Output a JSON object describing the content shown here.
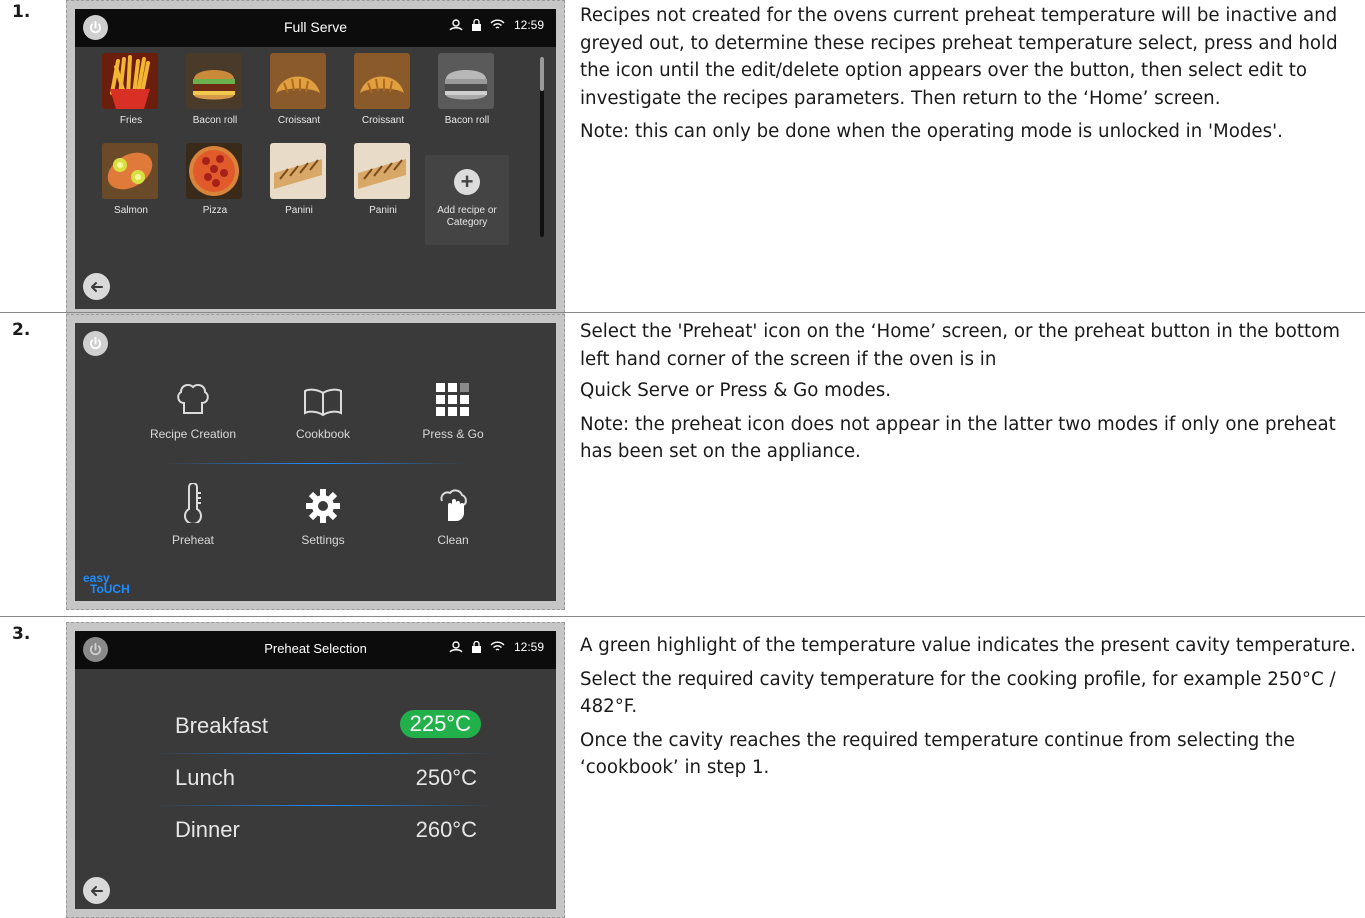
{
  "steps": [
    {
      "number": "1.",
      "screen": {
        "title": "Full Serve",
        "time": "12:59",
        "recipes": [
          {
            "label": "Fries",
            "icon": "fries-image"
          },
          {
            "label": "Bacon roll",
            "icon": "burger-image"
          },
          {
            "label": "Croissant",
            "icon": "croissant-image"
          },
          {
            "label": "Croissant",
            "icon": "croissant-image"
          },
          {
            "label": "Bacon roll",
            "icon": "burger-image-greyed"
          },
          {
            "label": "Salmon",
            "icon": "salmon-image"
          },
          {
            "label": "Pizza",
            "icon": "pizza-image"
          },
          {
            "label": "Panini",
            "icon": "panini-image"
          },
          {
            "label": "Panini",
            "icon": "panini-image"
          }
        ],
        "add_tile_label_1": "Add recipe or",
        "add_tile_label_2": "Category"
      },
      "paragraphs": [
        "Recipes not created for the ovens current preheat temperature will be inactive and greyed out, to determine these recipes preheat temperature select, press and hold the icon until the edit/delete option appears over the button, then select edit to investigate the recipes parameters. Then return to the ‘Home’ screen.",
        "Note: this can only be done when the operating mode is unlocked in 'Modes'."
      ]
    },
    {
      "number": "2.",
      "screen": {
        "menu": [
          {
            "label": "Recipe Creation",
            "icon": "chef-hat-icon"
          },
          {
            "label": "Cookbook",
            "icon": "book-icon"
          },
          {
            "label": "Press & Go",
            "icon": "grid-icon"
          },
          {
            "label": "Preheat",
            "icon": "thermometer-icon"
          },
          {
            "label": "Settings",
            "icon": "gear-icon"
          },
          {
            "label": "Clean",
            "icon": "clean-hand-icon"
          }
        ],
        "brand_line_1": "easy",
        "brand_line_2": "ToUCH"
      },
      "paragraphs": [
        "Select the 'Preheat' icon on the ‘Home’ screen, or the preheat button in the bottom left hand corner of the screen if the oven is in",
        "Quick Serve or Press & Go modes.",
        "Note: the preheat icon does not appear in the latter two modes if only one preheat has been set on the appliance."
      ]
    },
    {
      "number": "3.",
      "screen": {
        "title": "Preheat Selection",
        "time": "12:59",
        "options": [
          {
            "name": "Breakfast",
            "temp": "225°C",
            "active": true
          },
          {
            "name": "Lunch",
            "temp": "250°C",
            "active": false
          },
          {
            "name": "Dinner",
            "temp": "260°C",
            "active": false
          }
        ],
        "active_color": "#22b04a"
      },
      "paragraphs": [
        "A green highlight of the temperature value indicates the present cavity temperature.",
        "Select the required cavity temperature for the cooking profile, for example 250°C / 482°F.",
        "Once the cavity reaches the required temperature continue from selecting the ‘cookbook’ in step 1."
      ]
    }
  ]
}
